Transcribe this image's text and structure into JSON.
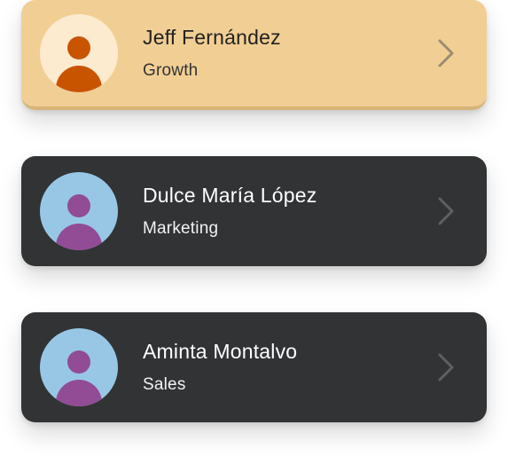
{
  "contacts": [
    {
      "name": "Jeff Fernández",
      "department": "Growth",
      "selected": true,
      "colors": {
        "card_bg": "#f1cf94",
        "name": "#222222",
        "department": "#333333",
        "avatar_bg": "#fdebd0",
        "avatar_figure": "#c85400",
        "chevron": "#9c8b74"
      }
    },
    {
      "name": "Dulce María López",
      "department": "Marketing",
      "selected": false,
      "colors": {
        "card_bg": "#313335",
        "name": "#ffffff",
        "department": "#f2f2f2",
        "avatar_bg": "#98c7e6",
        "avatar_figure": "#914c95",
        "chevron": "#5d6064"
      }
    },
    {
      "name": "Aminta Montalvo",
      "department": "Sales",
      "selected": false,
      "colors": {
        "card_bg": "#313335",
        "name": "#ffffff",
        "department": "#f2f2f2",
        "avatar_bg": "#98c7e6",
        "avatar_figure": "#914c95",
        "chevron": "#5d6064"
      }
    }
  ],
  "icons": {
    "avatar": "user-avatar-icon",
    "chevron": "chevron-right-icon"
  }
}
